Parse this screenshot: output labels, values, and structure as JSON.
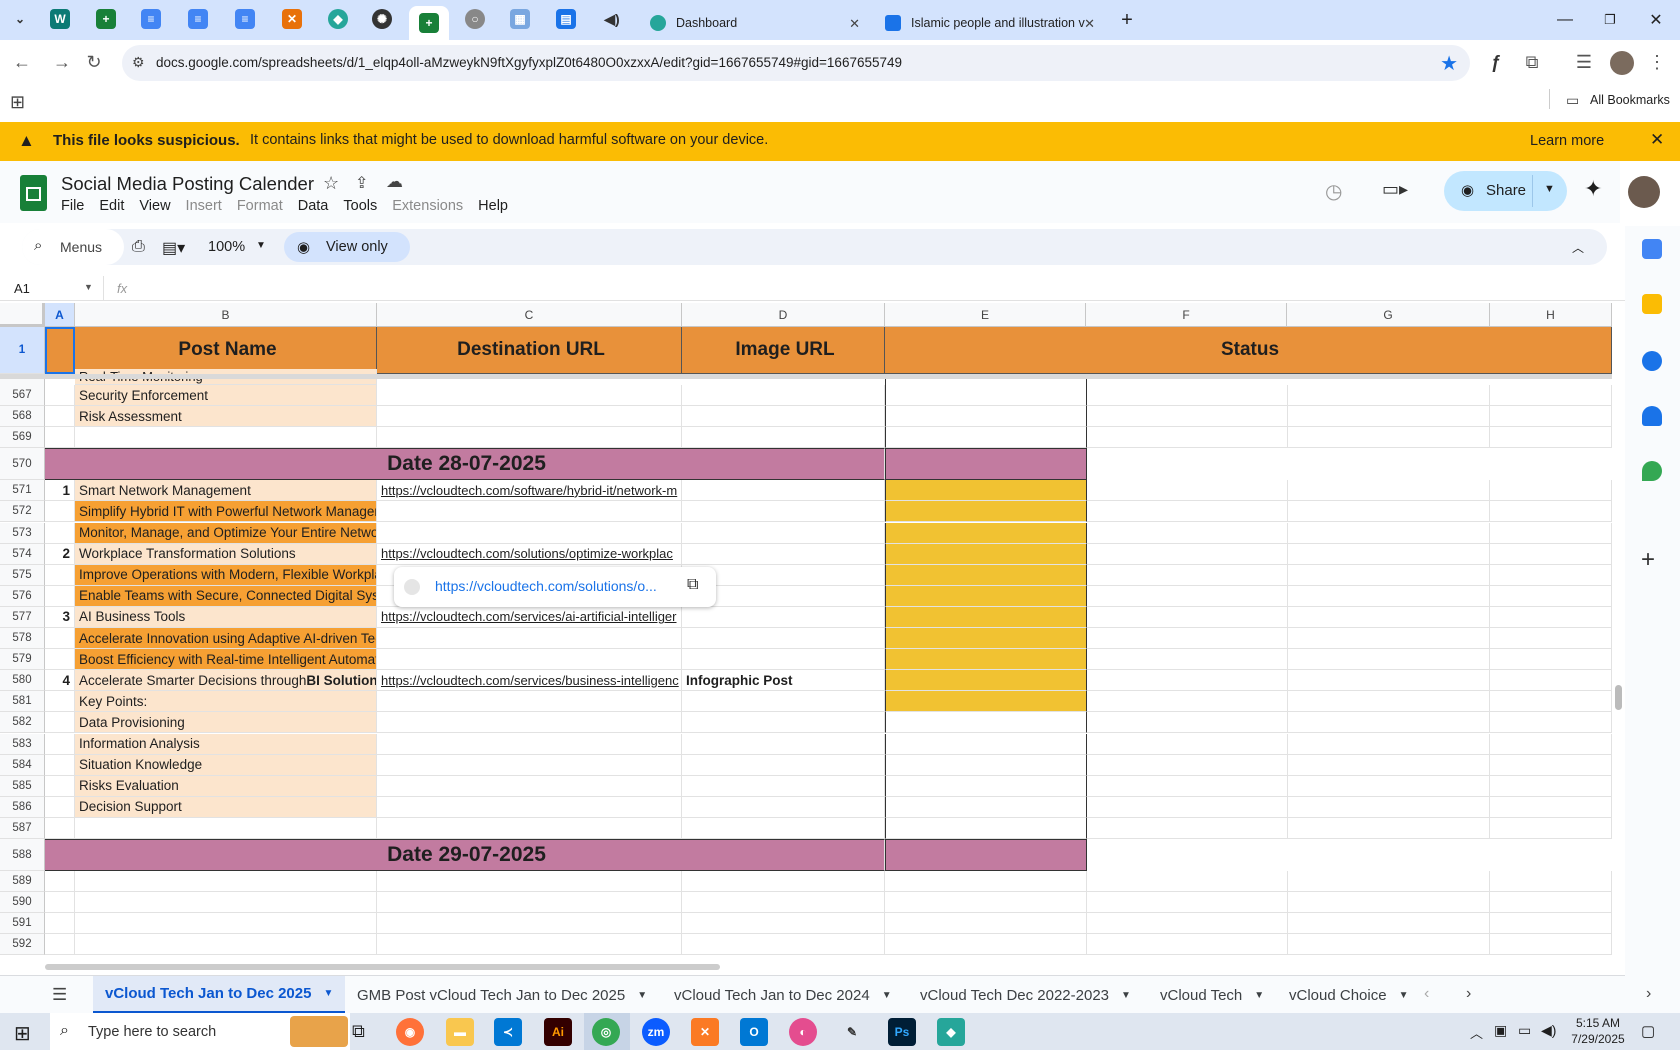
{
  "browser": {
    "tabs": [
      {
        "title": "Dashboard"
      },
      {
        "title": "Islamic people and illustration v"
      }
    ],
    "url": "docs.google.com/spreadsheets/d/1_elqp4oll-aMzweykN9ftXgyfyxplZ0t6480O0xzxxA/edit?gid=1667655749#gid=1667655749",
    "bookmarks_label": "All Bookmarks"
  },
  "warning": {
    "title": "This file looks suspicious.",
    "message": "It contains links that might be used to download harmful software on your device.",
    "learn_more": "Learn more"
  },
  "doc": {
    "title": "Social Media Posting Calender",
    "menus": [
      "File",
      "Edit",
      "View",
      "Insert",
      "Format",
      "Data",
      "Tools",
      "Extensions",
      "Help"
    ],
    "share_label": "Share"
  },
  "toolbar": {
    "search_placeholder": "Menus",
    "zoom": "100%",
    "view_only": "View only"
  },
  "formula": {
    "cell_ref": "A1",
    "fx": "fx"
  },
  "grid": {
    "columns": [
      "A",
      "B",
      "C",
      "D",
      "E",
      "F",
      "G",
      "H"
    ],
    "header_row": {
      "row": "1",
      "post_name": "Post Name",
      "destination_url": "Destination URL",
      "image_url": "Image URL",
      "status": "Status"
    },
    "partial_top": "Real-Time Monitoring",
    "rows": [
      {
        "row": "567",
        "num": "",
        "b": "Security Enforcement",
        "c": "",
        "d": ""
      },
      {
        "row": "568",
        "num": "",
        "b": "Risk Assessment",
        "c": "",
        "d": ""
      },
      {
        "row": "569",
        "num": "",
        "b": "",
        "c": "",
        "d": ""
      },
      {
        "row": "570",
        "date": "Date 28-07-2025"
      },
      {
        "row": "571",
        "num": "1",
        "b": "Smart Network Management",
        "c": "https://vcloudtech.com/software/hybrid-it/network-m",
        "d": ""
      },
      {
        "row": "572",
        "num": "",
        "b": "Simplify Hybrid IT with Powerful Network Managen",
        "c": "",
        "d": ""
      },
      {
        "row": "573",
        "num": "",
        "b": "Monitor, Manage, and Optimize Your Entire Networ",
        "c": "",
        "d": ""
      },
      {
        "row": "574",
        "num": "2",
        "b": "Workplace Transformation Solutions",
        "c": "https://vcloudtech.com/solutions/optimize-workplac",
        "d": ""
      },
      {
        "row": "575",
        "num": "",
        "b": "Improve Operations with Modern, Flexible Workpla",
        "c": "",
        "d": ""
      },
      {
        "row": "576",
        "num": "",
        "b": "Enable Teams with Secure, Connected Digital Syst",
        "c": "",
        "d": ""
      },
      {
        "row": "577",
        "num": "3",
        "b": "AI Business Tools",
        "c": "https://vcloudtech.com/services/ai-artificial-intelliger",
        "d": ""
      },
      {
        "row": "578",
        "num": "",
        "b": "Accelerate Innovation using Adaptive AI-driven Tec",
        "c": "",
        "d": ""
      },
      {
        "row": "579",
        "num": "",
        "b": "Boost Efficiency with Real-time Intelligent Automat",
        "c": "",
        "d": ""
      },
      {
        "row": "580",
        "num": "4",
        "b": "Accelerate Smarter Decisions through ",
        "b_bold": "BI Solution",
        "c": "https://vcloudtech.com/services/business-intelligenc",
        "d": "Infographic Post"
      },
      {
        "row": "581",
        "num": "",
        "b": "Key Points:",
        "c": "",
        "d": ""
      },
      {
        "row": "582",
        "num": "",
        "b": "Data Provisioning",
        "c": "",
        "d": ""
      },
      {
        "row": "583",
        "num": "",
        "b": "Information Analysis",
        "c": "",
        "d": ""
      },
      {
        "row": "584",
        "num": "",
        "b": "Situation Knowledge",
        "c": "",
        "d": ""
      },
      {
        "row": "585",
        "num": "",
        "b": "Risks Evaluation",
        "c": "",
        "d": ""
      },
      {
        "row": "586",
        "num": "",
        "b": "Decision Support",
        "c": "",
        "d": ""
      },
      {
        "row": "587",
        "num": "",
        "b": "",
        "c": "",
        "d": ""
      },
      {
        "row": "588",
        "date": "Date 29-07-2025"
      },
      {
        "row": "589",
        "num": "",
        "b": "",
        "c": "",
        "d": ""
      },
      {
        "row": "590",
        "num": "",
        "b": "",
        "c": "",
        "d": ""
      },
      {
        "row": "591",
        "num": "",
        "b": "",
        "c": "",
        "d": ""
      },
      {
        "row": "592",
        "num": "",
        "b": "",
        "c": "",
        "d": ""
      }
    ],
    "link_popup": "https://vcloudtech.com/solutions/o..."
  },
  "sheet_tabs": [
    "vCloud Tech Jan to Dec 2025",
    "GMB Post vCloud Tech Jan to Dec 2025",
    "vCloud Tech Jan to Dec 2024",
    "vCloud Tech Dec 2022-2023",
    "vCloud Tech",
    "vCloud Choice"
  ],
  "taskbar": {
    "search_placeholder": "Type here to search",
    "time": "5:15 AM",
    "date": "7/29/2025"
  },
  "colors": {
    "header_orange": "#e8913a",
    "date_band": "#c27ba0",
    "light_peach": "#fce5cd",
    "bright_orange": "#f6a033",
    "status_yellow": "#f1c232",
    "warning_yellow": "#fbbc04",
    "tabbar_blue": "#d3e3fd"
  }
}
